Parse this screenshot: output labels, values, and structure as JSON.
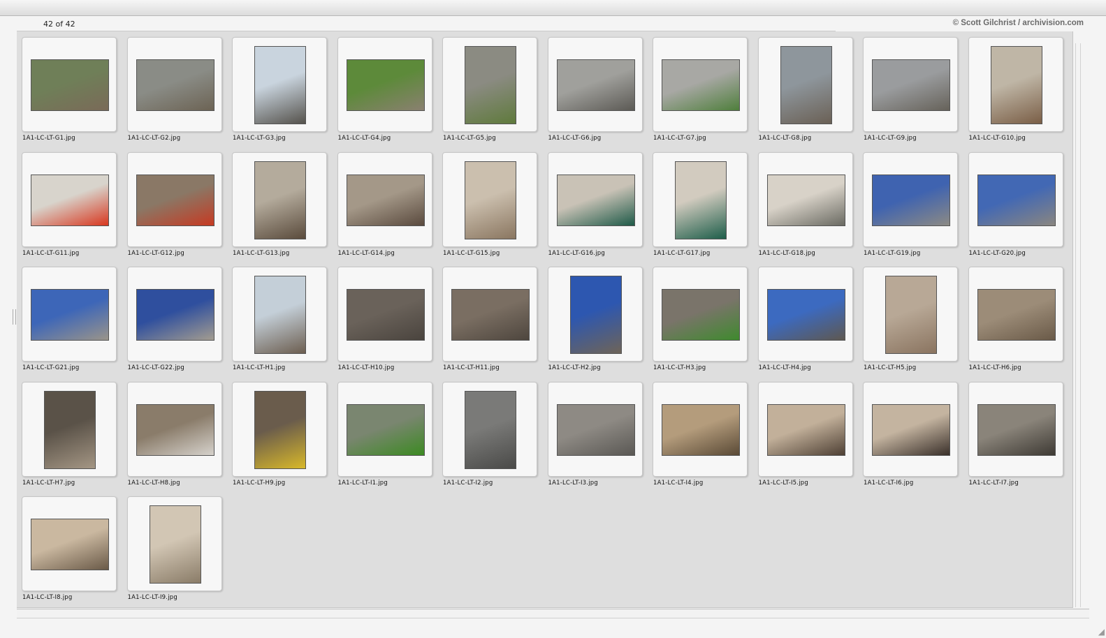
{
  "header": {
    "count": "42 of 42",
    "credit": "© Scott Gilchrist / archivision.com"
  },
  "items": [
    {
      "filename": "1A1-LC-LT-G1.jpg",
      "orientation": "landscape",
      "c1": "#6f7f58",
      "c2": "#7a6a58"
    },
    {
      "filename": "1A1-LC-LT-G2.jpg",
      "orientation": "landscape",
      "c1": "#8a8c86",
      "c2": "#6c6354"
    },
    {
      "filename": "1A1-LC-LT-G3.jpg",
      "orientation": "portrait",
      "c1": "#c9d4de",
      "c2": "#55524c"
    },
    {
      "filename": "1A1-LC-LT-G4.jpg",
      "orientation": "landscape",
      "c1": "#5d8a3a",
      "c2": "#8a8070"
    },
    {
      "filename": "1A1-LC-LT-G5.jpg",
      "orientation": "portrait",
      "c1": "#8b8b82",
      "c2": "#5f7a3c"
    },
    {
      "filename": "1A1-LC-LT-G6.jpg",
      "orientation": "landscape",
      "c1": "#a0a09c",
      "c2": "#5c5a55"
    },
    {
      "filename": "1A1-LC-LT-G7.jpg",
      "orientation": "landscape",
      "c1": "#a8a8a4",
      "c2": "#4f7f3c"
    },
    {
      "filename": "1A1-LC-LT-G8.jpg",
      "orientation": "portrait",
      "c1": "#8e969c",
      "c2": "#6a6055"
    },
    {
      "filename": "1A1-LC-LT-G9.jpg",
      "orientation": "landscape",
      "c1": "#9a9c9e",
      "c2": "#66625a"
    },
    {
      "filename": "1A1-LC-LT-G10.jpg",
      "orientation": "portrait",
      "c1": "#bfb6a6",
      "c2": "#7a5e46"
    },
    {
      "filename": "1A1-LC-LT-G11.jpg",
      "orientation": "landscape",
      "c1": "#d8d4cc",
      "c2": "#d8371f"
    },
    {
      "filename": "1A1-LC-LT-G12.jpg",
      "orientation": "landscape",
      "c1": "#8a7866",
      "c2": "#c63a22"
    },
    {
      "filename": "1A1-LC-LT-G13.jpg",
      "orientation": "portrait",
      "c1": "#b4ab9c",
      "c2": "#5a4b3c"
    },
    {
      "filename": "1A1-LC-LT-G14.jpg",
      "orientation": "landscape",
      "c1": "#a49888",
      "c2": "#5a4a3e"
    },
    {
      "filename": "1A1-LC-LT-G15.jpg",
      "orientation": "portrait",
      "c1": "#cbbfae",
      "c2": "#8a7660"
    },
    {
      "filename": "1A1-LC-LT-G16.jpg",
      "orientation": "landscape",
      "c1": "#c9c2b6",
      "c2": "#1f5a48"
    },
    {
      "filename": "1A1-LC-LT-G17.jpg",
      "orientation": "portrait",
      "c1": "#d2cbbf",
      "c2": "#1e5e4a"
    },
    {
      "filename": "1A1-LC-LT-G18.jpg",
      "orientation": "landscape",
      "c1": "#d8d2c8",
      "c2": "#6a6a62"
    },
    {
      "filename": "1A1-LC-LT-G19.jpg",
      "orientation": "landscape",
      "c1": "#3f63b0",
      "c2": "#8c8a84"
    },
    {
      "filename": "1A1-LC-LT-G20.jpg",
      "orientation": "landscape",
      "c1": "#4268b4",
      "c2": "#8a8680"
    },
    {
      "filename": "1A1-LC-LT-G21.jpg",
      "orientation": "landscape",
      "c1": "#3d66b8",
      "c2": "#9a948a"
    },
    {
      "filename": "1A1-LC-LT-G22.jpg",
      "orientation": "landscape",
      "c1": "#2f4f9e",
      "c2": "#a39c90"
    },
    {
      "filename": "1A1-LC-LT-H1.jpg",
      "orientation": "portrait",
      "c1": "#c4cfd8",
      "c2": "#6c5e50"
    },
    {
      "filename": "1A1-LC-LT-H10.jpg",
      "orientation": "landscape",
      "c1": "#6a625a",
      "c2": "#4a443e"
    },
    {
      "filename": "1A1-LC-LT-H11.jpg",
      "orientation": "landscape",
      "c1": "#7a6e62",
      "c2": "#4e463e"
    },
    {
      "filename": "1A1-LC-LT-H2.jpg",
      "orientation": "portrait",
      "c1": "#2d57b0",
      "c2": "#6e6458"
    },
    {
      "filename": "1A1-LC-LT-H3.jpg",
      "orientation": "landscape",
      "c1": "#7a746a",
      "c2": "#3f8a2e"
    },
    {
      "filename": "1A1-LC-LT-H4.jpg",
      "orientation": "landscape",
      "c1": "#3c6ac0",
      "c2": "#5e5850"
    },
    {
      "filename": "1A1-LC-LT-H5.jpg",
      "orientation": "portrait",
      "c1": "#b8a896",
      "c2": "#8a7460"
    },
    {
      "filename": "1A1-LC-LT-H6.jpg",
      "orientation": "landscape",
      "c1": "#9c8c78",
      "c2": "#6a5a48"
    },
    {
      "filename": "1A1-LC-LT-H7.jpg",
      "orientation": "portrait",
      "c1": "#5a5248",
      "c2": "#a49684"
    },
    {
      "filename": "1A1-LC-LT-H8.jpg",
      "orientation": "landscape",
      "c1": "#8a7c6a",
      "c2": "#d6d2cc"
    },
    {
      "filename": "1A1-LC-LT-H9.jpg",
      "orientation": "portrait",
      "c1": "#6a5c4c",
      "c2": "#d8b82a"
    },
    {
      "filename": "1A1-LC-LT-I1.jpg",
      "orientation": "landscape",
      "c1": "#7a8670",
      "c2": "#3c8a22"
    },
    {
      "filename": "1A1-LC-LT-I2.jpg",
      "orientation": "portrait",
      "c1": "#7a7a78",
      "c2": "#4a4a48"
    },
    {
      "filename": "1A1-LC-LT-I3.jpg",
      "orientation": "landscape",
      "c1": "#8e8a84",
      "c2": "#5a5854"
    },
    {
      "filename": "1A1-LC-LT-I4.jpg",
      "orientation": "landscape",
      "c1": "#b49c7c",
      "c2": "#5a4a36"
    },
    {
      "filename": "1A1-LC-LT-I5.jpg",
      "orientation": "landscape",
      "c1": "#c2b09a",
      "c2": "#4e4034"
    },
    {
      "filename": "1A1-LC-LT-I6.jpg",
      "orientation": "landscape",
      "c1": "#c4b4a0",
      "c2": "#3a302a"
    },
    {
      "filename": "1A1-LC-LT-I7.jpg",
      "orientation": "landscape",
      "c1": "#8a847a",
      "c2": "#3e3a34"
    },
    {
      "filename": "1A1-LC-LT-I8.jpg",
      "orientation": "landscape",
      "c1": "#cab8a0",
      "c2": "#6a5a48"
    },
    {
      "filename": "1A1-LC-LT-I9.jpg",
      "orientation": "portrait",
      "c1": "#d2c6b4",
      "c2": "#8a7c68"
    }
  ]
}
